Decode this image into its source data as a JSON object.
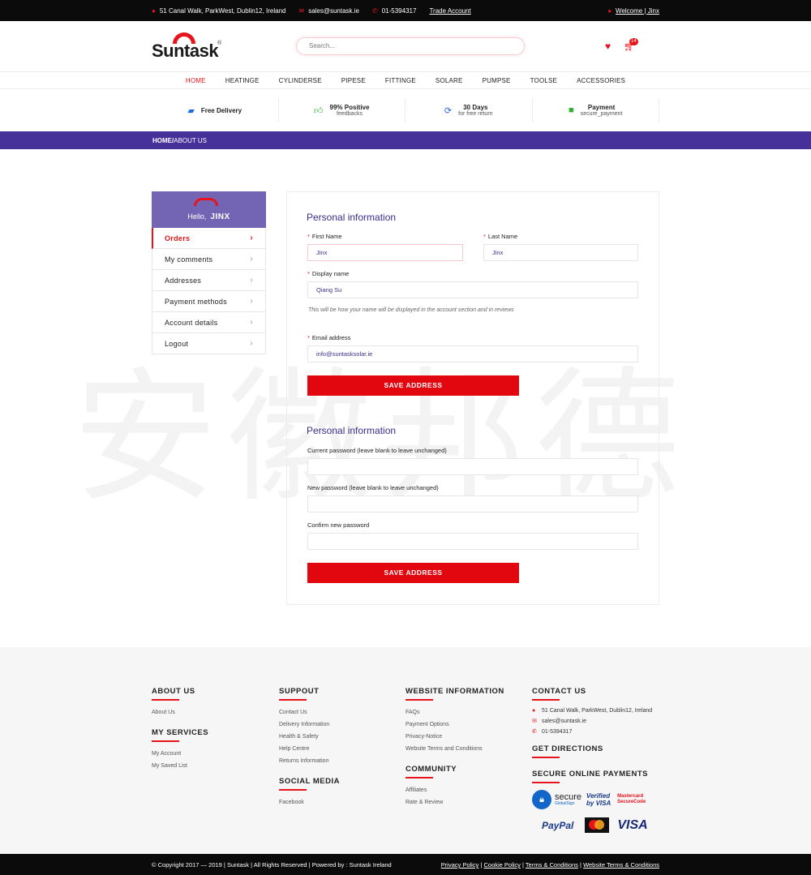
{
  "topbar": {
    "address": "51 Canal Walk, ParkWest, Dublin12, Ireland",
    "email": "sales@suntask.ie",
    "phone": "01-5394317",
    "trade_account": "Trade Account",
    "welcome": "Welcome | Jinx"
  },
  "header": {
    "logo_text": "Suntask",
    "logo_reg": "®",
    "search_placeholder": "Search...",
    "cart_count": "14"
  },
  "nav": [
    "HOME",
    "HEATINGE",
    "CYLINDERSE",
    "PIPESE",
    "FITTINGE",
    "SOLARE",
    "PUMPSE",
    "TOOLSE",
    "ACCESSORIES"
  ],
  "features": [
    {
      "title": "Free Delivery",
      "sub": "",
      "icon": "truck-icon",
      "color": "#1e6fd8"
    },
    {
      "title": "99% Positive",
      "sub": "feedbacks",
      "icon": "thumbs-up-icon",
      "color": "#2bb32b"
    },
    {
      "title": "30 Days",
      "sub": "for free return",
      "icon": "refresh-icon",
      "color": "#1e6fd8"
    },
    {
      "title": "Payment",
      "sub": "secure_payment",
      "icon": "lock-icon",
      "color": "#2bb32b"
    }
  ],
  "breadcrumb": {
    "home": "HOME/",
    "current": "ABOUT US"
  },
  "watermark": "安徽邦德",
  "sidebar": {
    "hello": "Hello,",
    "name": "JINX",
    "items": [
      "Orders",
      "My comments",
      "Addresses",
      "Payment methods",
      "Account details",
      "Logout"
    ]
  },
  "form": {
    "section1_title": "Personal information",
    "first_name_label": "First Name",
    "first_name_value": "Jinx",
    "last_name_label": "Last Name",
    "last_name_value": "Jinx",
    "display_name_label": "Display name",
    "display_name_value": "Qiang Su",
    "display_hint": "This will be how your name will be displayed in the account section and in reviews",
    "email_label": "Email address",
    "email_value": "info@suntasksolar.ie",
    "save1": "SAVE ADDRESS",
    "section2_title": "Personal information",
    "current_pw_label": "Current password (leave blank to leave unchanged)",
    "new_pw_label": "New password (leave blank to leave unchanged)",
    "confirm_pw_label": "Confirm new password",
    "save2": "SAVE ADDRESS"
  },
  "footer": {
    "about_title": "ABOUT US",
    "about_links": [
      "About Us"
    ],
    "services_title": "MY SERVICES",
    "services_links": [
      "My Account",
      "My Saved List"
    ],
    "support_title": "SUPPOUT",
    "support_links": [
      "Contact Us",
      "Delivery Information",
      "Health & Safety",
      "Help Centre",
      "Returns Information"
    ],
    "social_title": "SOCIAL MEDIA",
    "social_links": [
      "Facebook"
    ],
    "webinfo_title": "WEBSITE INFORMATION",
    "webinfo_links": [
      "FAQs",
      "Payment Options",
      "Privacy-Notice",
      "Website Terms and Conditions"
    ],
    "community_title": "COMMUNITY",
    "community_links": [
      "Affiliates",
      "Rate & Review"
    ],
    "contact_title": "CONTACT US",
    "contact_address": "51 Canal Walk, ParkWest, Dublin12, Ireland",
    "contact_email": "sales@suntask.ie",
    "contact_phone": "01-5394317",
    "directions_title": "GET DIRECTIONS",
    "payments_title": "SECURE ONLINE PAYMENTS",
    "gs_title": "secure",
    "gs_sub": "GlobalSign",
    "vbv": "Verified by VISA",
    "msc": "Mastercard SecureCode",
    "paypal": "PayPal",
    "visa": "VISA"
  },
  "copyright": {
    "text": "© Copyright 2017 — 2019 | Suntask | All Rights Reserved | Powered by : Suntask Ireland",
    "links": [
      "Privacy Policy",
      "Cookie Policy",
      "Terms & Conditions",
      "Website Terms & Conditions"
    ]
  },
  "colors": {
    "accent": "#e8141b",
    "brand_purple": "#46309a",
    "sidebar_purple": "#7465b4"
  }
}
